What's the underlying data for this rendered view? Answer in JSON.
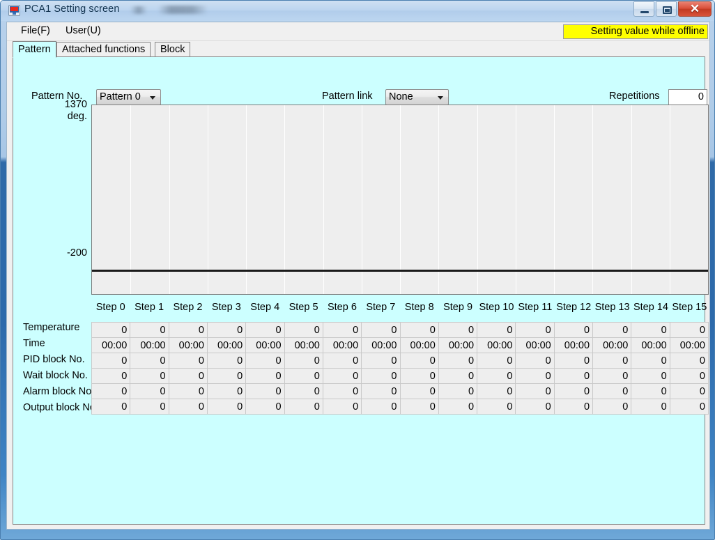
{
  "window": {
    "title": "PCA1 Setting screen",
    "icon": "monitor-icon",
    "minimize_label": "",
    "maximize_label": "",
    "close_label": "✕"
  },
  "menubar": {
    "items": [
      {
        "label": "File(F)",
        "name": "menu-file"
      },
      {
        "label": "User(U)",
        "name": "menu-user"
      }
    ],
    "offline_badge": "Setting value while offline",
    "offline_badge_color": "#ffff00"
  },
  "tabs": [
    {
      "label": "Pattern",
      "active": true
    },
    {
      "label": "Attached functions",
      "active": false
    },
    {
      "label": "Block",
      "active": false
    }
  ],
  "controls": {
    "pattern_no_label": "Pattern No.",
    "pattern_no_value": "Pattern 0",
    "pattern_link_label": "Pattern link",
    "pattern_link_value": "None",
    "repetitions_label": "Repetitions",
    "repetitions_value": "0"
  },
  "chart_data": {
    "type": "line",
    "title": "",
    "xlabel": "",
    "ylabel": "deg.",
    "ylim": [
      -200,
      1370
    ],
    "y_tick_labels": [
      "1370",
      "-200"
    ],
    "unit_label": "deg.",
    "grid": true,
    "legend": "none",
    "categories": [
      "Step 0",
      "Step 1",
      "Step 2",
      "Step 3",
      "Step 4",
      "Step 5",
      "Step 6",
      "Step 7",
      "Step 8",
      "Step 9",
      "Step 10",
      "Step 11",
      "Step 12",
      "Step 13",
      "Step 14",
      "Step 15"
    ],
    "series": [
      {
        "name": "Temperature",
        "values": [
          0,
          0,
          0,
          0,
          0,
          0,
          0,
          0,
          0,
          0,
          0,
          0,
          0,
          0,
          0,
          0
        ]
      }
    ],
    "plot_bg": "#eeeeee",
    "line_color": "#1a1a1a"
  },
  "grid": {
    "row_labels": [
      "Temperature",
      "Time",
      "PID block No.",
      "Wait block No.",
      "Alarm block No.",
      "Output block No."
    ],
    "rows": [
      {
        "label": "Temperature",
        "values": [
          "0",
          "0",
          "0",
          "0",
          "0",
          "0",
          "0",
          "0",
          "0",
          "0",
          "0",
          "0",
          "0",
          "0",
          "0",
          "0"
        ]
      },
      {
        "label": "Time",
        "values": [
          "00:00",
          "00:00",
          "00:00",
          "00:00",
          "00:00",
          "00:00",
          "00:00",
          "00:00",
          "00:00",
          "00:00",
          "00:00",
          "00:00",
          "00:00",
          "00:00",
          "00:00",
          "00:00"
        ]
      },
      {
        "label": "PID block No.",
        "values": [
          "0",
          "0",
          "0",
          "0",
          "0",
          "0",
          "0",
          "0",
          "0",
          "0",
          "0",
          "0",
          "0",
          "0",
          "0",
          "0"
        ]
      },
      {
        "label": "Wait block No.",
        "values": [
          "0",
          "0",
          "0",
          "0",
          "0",
          "0",
          "0",
          "0",
          "0",
          "0",
          "0",
          "0",
          "0",
          "0",
          "0",
          "0"
        ]
      },
      {
        "label": "Alarm block No.",
        "values": [
          "0",
          "0",
          "0",
          "0",
          "0",
          "0",
          "0",
          "0",
          "0",
          "0",
          "0",
          "0",
          "0",
          "0",
          "0",
          "0"
        ]
      },
      {
        "label": "Output block No.",
        "values": [
          "0",
          "0",
          "0",
          "0",
          "0",
          "0",
          "0",
          "0",
          "0",
          "0",
          "0",
          "0",
          "0",
          "0",
          "0",
          "0"
        ]
      }
    ]
  },
  "theme": {
    "panel_bg": "#ccffff",
    "chrome_bg": "#f0f0f0",
    "frame_blue": "#2d6aab",
    "accent_red": "#c23a22"
  }
}
